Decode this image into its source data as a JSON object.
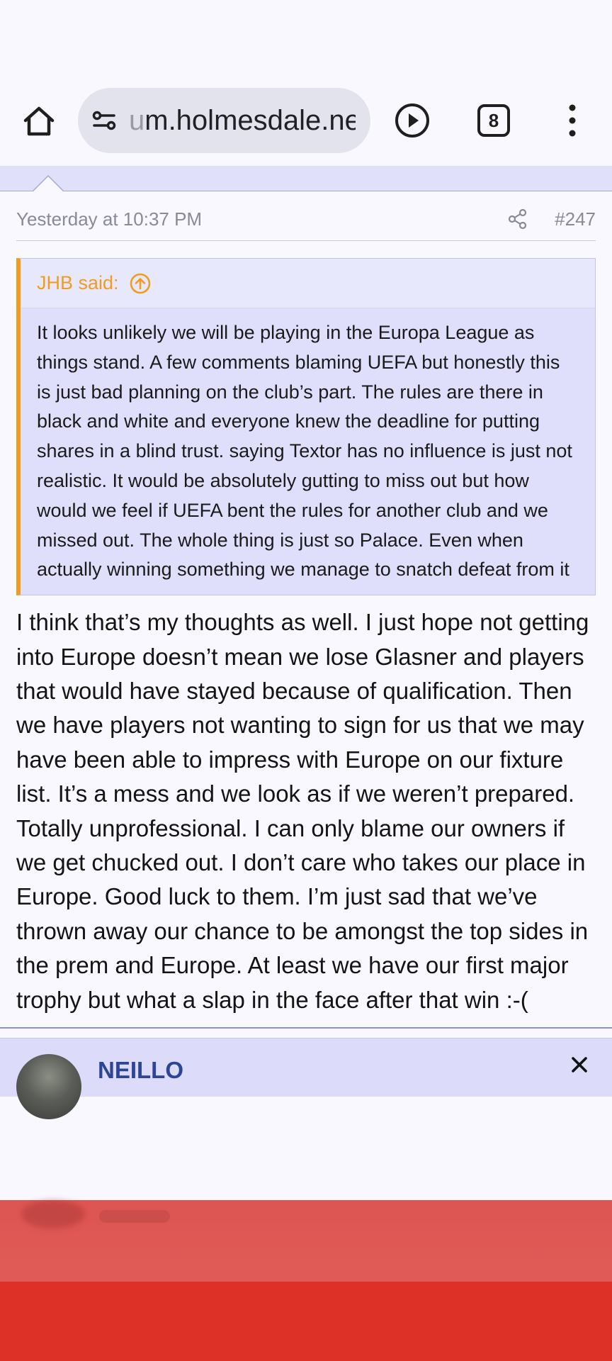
{
  "browser": {
    "url_prefix": "u",
    "url_rest": "m.holmesdale.net",
    "tab_count": "8"
  },
  "post": {
    "timestamp": "Yesterday at 10:37 PM",
    "post_number": "#247",
    "quote": {
      "author": "JHB said:",
      "text": "It looks unlikely we will be playing in the Europa League as things stand. A few comments blaming UEFA but honestly this is just bad planning on the club’s part. The rules are there in black and white and everyone knew the deadline for putting shares in a blind trust. saying Textor has no influence is just not realistic. It would be absolutely gutting to miss out but how would we feel if UEFA bent the rules for another club and we missed out. The whole thing is just so Palace. Even when actually winning something we manage to snatch defeat from it"
    },
    "body": "I think that’s my thoughts as well. I just hope not getting into Europe doesn’t mean we lose Glasner and players that would have stayed because of qualification. Then we have players not wanting to sign for us that we may have been able to impress with Europe on our fixture list. It’s a mess and we look as if we weren’t prepared. Totally unprofessional. I can only blame our owners if we get chucked out. I don’t care who takes our place in Europe. Good luck to them. I’m just sad that we’ve thrown away our chance to be amongst the top sides in the prem and Europe. At least we have our first major trophy but what a slap in the face after that win :-("
  },
  "next_post": {
    "username": "NEILLO"
  },
  "colors": {
    "quote_accent": "#f29c1f",
    "username": "#2c4596",
    "ad_red": "#dd3027"
  }
}
